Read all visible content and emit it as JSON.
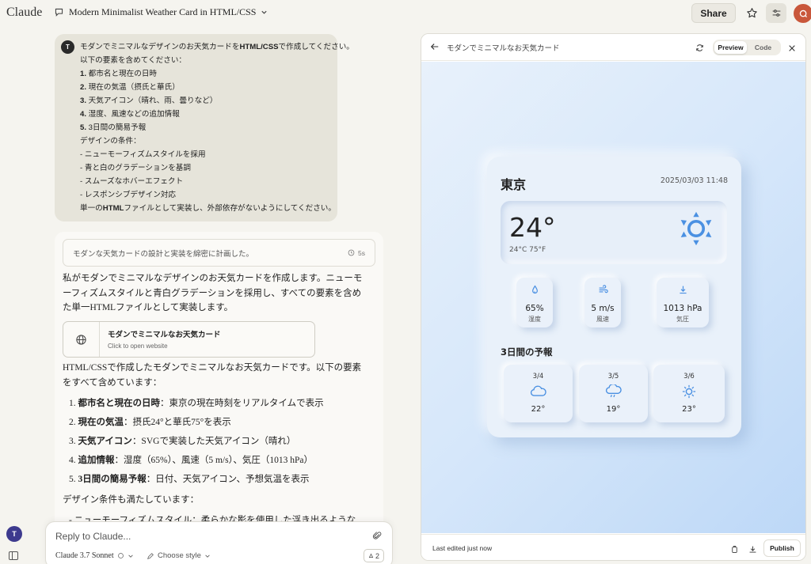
{
  "app": {
    "brand": "Claude"
  },
  "conversation": {
    "title": "Modern Minimalist Weather Card in HTML/CSS"
  },
  "header": {
    "share_label": "Share",
    "user_initial": "Q"
  },
  "user_message": {
    "avatar_initial": "T",
    "lines": [
      {
        "bold": "",
        "text": "モダンでミニマルなデザインのお天気カードを"
      },
      {
        "bold": "",
        "text": "以下の要素を含めてください："
      },
      {
        "bold": "1.",
        "text": " 都市名と現在の日時"
      },
      {
        "bold": "2.",
        "text": " 現在の気温（摂氏と華氏）"
      },
      {
        "bold": "3.",
        "text": " 天気アイコン（晴れ、雨、曇りなど）"
      },
      {
        "bold": "4.",
        "text": " 湿度、風速などの追加情報"
      },
      {
        "bold": "5.",
        "text": " 3日間の簡易予報"
      },
      {
        "bold": "",
        "text": "デザインの条件："
      },
      {
        "bold": "",
        "text": "- ニューモーフィズムスタイルを採用"
      },
      {
        "bold": "",
        "text": "- 青と白のグラデーションを基調"
      },
      {
        "bold": "",
        "text": "- スムーズなホバーエフェクト"
      },
      {
        "bold": "",
        "text": "- レスポンシブデザイン対応"
      },
      {
        "bold": "",
        "text": "単一の"
      }
    ],
    "line1_bold": "HTML/CSS",
    "line1_tail": "で作成してください。",
    "last_bold": "HTML",
    "last_tail": "ファイルとして実装し、外部依存がないようにしてください。"
  },
  "assistant": {
    "thinking_label": "モダンな天気カードの設計と実装を綿密に計画した。",
    "thinking_time": "5s",
    "intro_lines": [
      "私がモダンでミニマルなデザインのお天気カードを作成します。ニューモ",
      "ーフィズムスタイルと青白グラデーションを採用し、すべての要素を含め",
      "た単一HTMLファイルとして実装します。"
    ],
    "artifact": {
      "title": "モダンでミニマルなお天気カード",
      "subtitle": "Click to open website"
    },
    "summary_lines": [
      "HTML/CSSで作成したモダンでミニマルなお天気カードです。以下の要素",
      "をすべて含めています："
    ],
    "list": [
      {
        "num": "1.",
        "bold": "都市名と現在の日時",
        "text": "：東京の現在時刻をリアルタイムで表示"
      },
      {
        "num": "2.",
        "bold": "現在の気温",
        "text": "：摂氏24°と華氏75°を表示"
      },
      {
        "num": "3.",
        "bold": "天気アイコン",
        "text": "：SVGで実装した天気アイコン（晴れ）"
      },
      {
        "num": "4.",
        "bold": "追加情報",
        "text": "：湿度（65%）、風速（5 m/s）、気圧（1013 hPa）"
      },
      {
        "num": "5.",
        "bold": "3日間の簡易予報",
        "text": "：日付、天気アイコン、予想気温を表示"
      }
    ],
    "conditions_line": "デザイン条件も満たしています：",
    "partial_line": "- ニューモーフィズムスタイル：柔らかな影を使用した浮き出るような"
  },
  "reply_box": {
    "placeholder": "Reply to Claude...",
    "model": "Claude 3.7 Sonnet",
    "style_label": "Choose style",
    "attachment_count": "2"
  },
  "sidebar": {
    "user_initial": "T"
  },
  "artifact_panel": {
    "title": "モダンでミニマルなお天気カード",
    "tabs": [
      "Preview",
      "Code"
    ],
    "active_tab": "Preview",
    "footer_status": "Last edited just now",
    "publish_label": "Publish"
  },
  "weather": {
    "city": "東京",
    "datetime": "2025/03/03 11:48",
    "temp": "24°",
    "temp_sub": "24°C 75°F",
    "icon": "sun-icon",
    "stats": [
      {
        "icon": "humidity-icon",
        "value": "65%",
        "label": "湿度"
      },
      {
        "icon": "wind-icon",
        "value": "5 m/s",
        "label": "風速"
      },
      {
        "icon": "pressure-icon",
        "value": "1013 hPa",
        "label": "気圧"
      }
    ],
    "forecast_title": "3日間の予報",
    "forecast": [
      {
        "date": "3/4",
        "icon": "cloud-icon",
        "temp": "22°"
      },
      {
        "date": "3/5",
        "icon": "rain-icon",
        "temp": "19°"
      },
      {
        "date": "3/6",
        "icon": "sun-icon",
        "temp": "23°"
      }
    ],
    "accent": "#4a90e2"
  }
}
